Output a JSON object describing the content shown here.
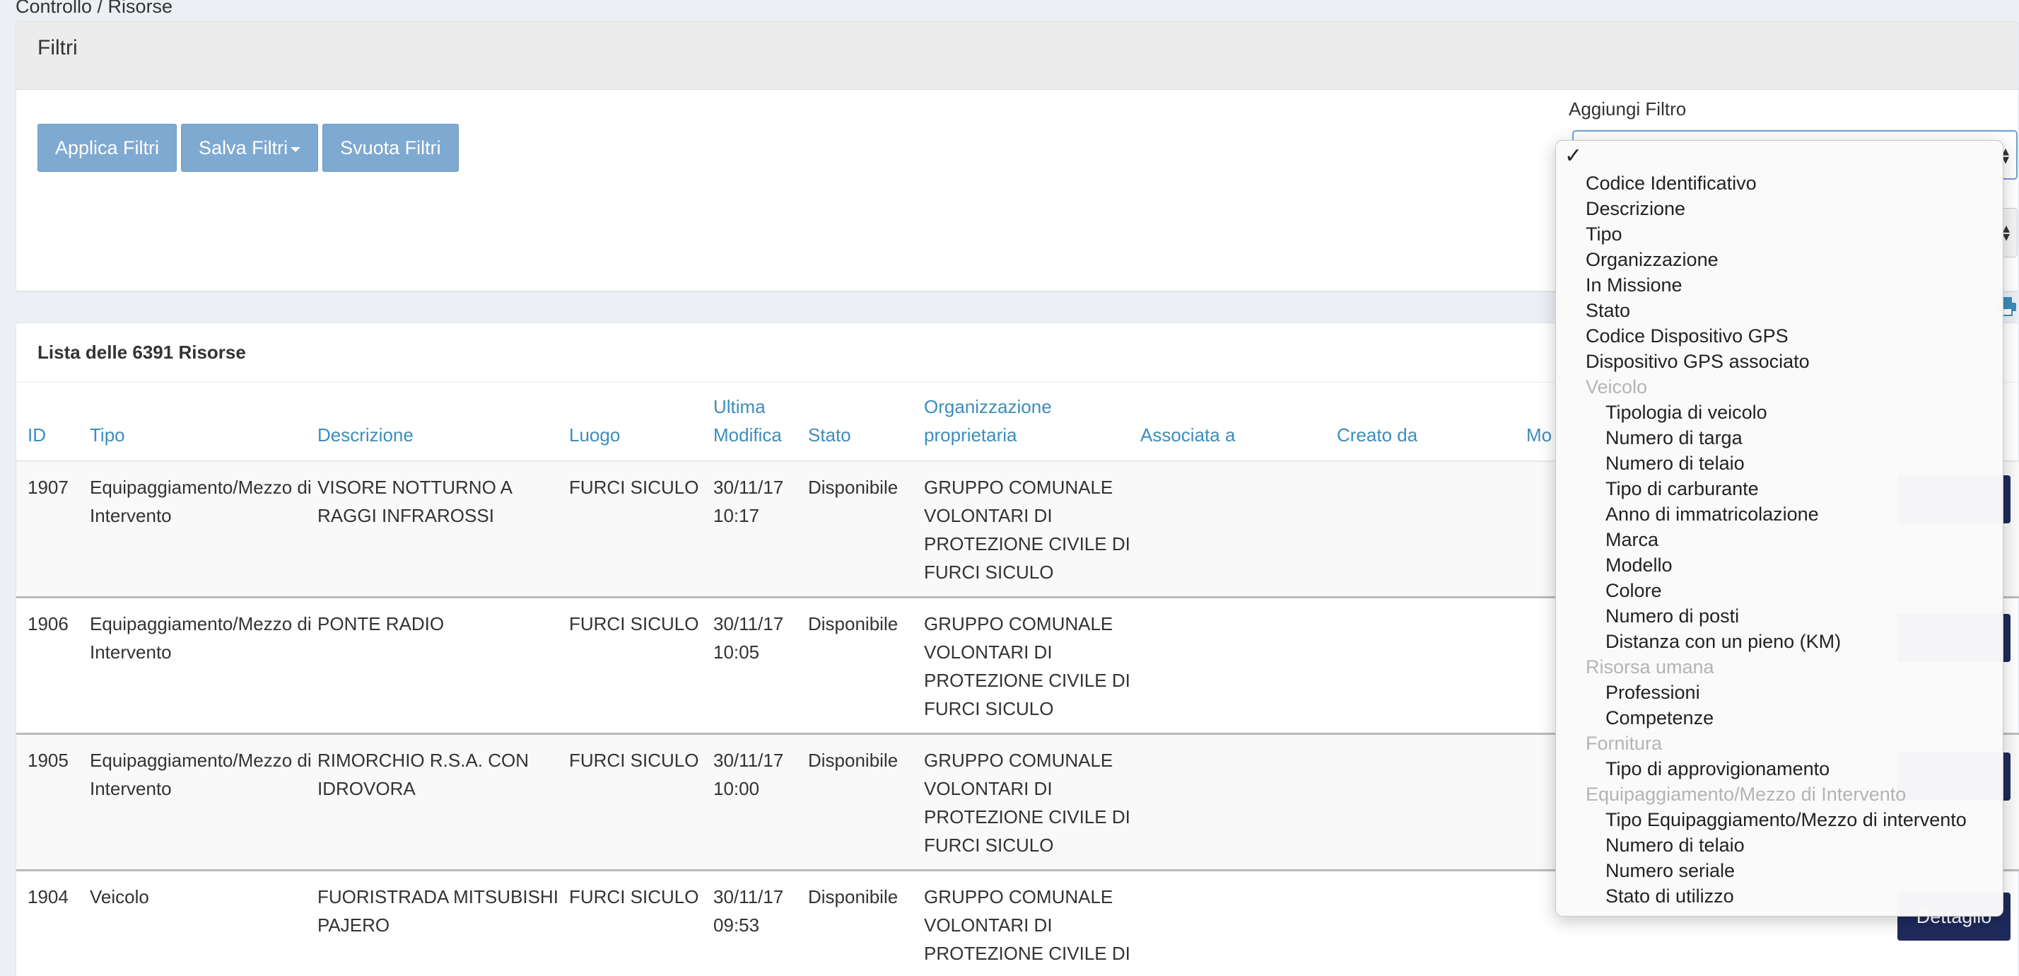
{
  "breadcrumb": "Controllo / Risorse",
  "filters": {
    "title": "Filtri",
    "apply_label": "Applica Filtri",
    "save_label": "Salva Filtri",
    "clear_label": "Svuota Filtri",
    "add_filter_label": "Aggiungi Filtro"
  },
  "list": {
    "title": "Lista delle 6391 Risorse",
    "columns": [
      "ID",
      "Tipo",
      "Descrizione",
      "Luogo",
      "Ultima Modifica",
      "Stato",
      "Organizzazione proprietaria",
      "Associata a",
      "Creato da",
      "Mo"
    ],
    "rows": [
      {
        "id": "1907",
        "tipo": "Equipaggiamento/Mezzo di Intervento",
        "descrizione": "VISORE NOTTURNO A RAGGI INFRAROSSI",
        "luogo": "FURCI SICULO",
        "modifica": "30/11/17 10:17",
        "stato": "Disponibile",
        "organizzazione": "GRUPPO COMUNALE VOLONTARI DI PROTEZIONE CIVILE DI FURCI SICULO",
        "associata": "",
        "creato": ""
      },
      {
        "id": "1906",
        "tipo": "Equipaggiamento/Mezzo di Intervento",
        "descrizione": "PONTE RADIO",
        "luogo": "FURCI SICULO",
        "modifica": "30/11/17 10:05",
        "stato": "Disponibile",
        "organizzazione": "GRUPPO COMUNALE VOLONTARI DI PROTEZIONE CIVILE DI FURCI SICULO",
        "associata": "",
        "creato": ""
      },
      {
        "id": "1905",
        "tipo": "Equipaggiamento/Mezzo di Intervento",
        "descrizione": "RIMORCHIO R.S.A. CON IDROVORA",
        "luogo": "FURCI SICULO",
        "modifica": "30/11/17 10:00",
        "stato": "Disponibile",
        "organizzazione": "GRUPPO COMUNALE VOLONTARI DI PROTEZIONE CIVILE DI FURCI SICULO",
        "associata": "",
        "creato": ""
      },
      {
        "id": "1904",
        "tipo": "Veicolo",
        "descrizione": "FUORISTRADA MITSUBISHI PAJERO",
        "luogo": "FURCI SICULO",
        "modifica": "30/11/17 09:53",
        "stato": "Disponibile",
        "organizzazione": "GRUPPO COMUNALE VOLONTARI DI PROTEZIONE CIVILE DI",
        "associata": "",
        "creato": ""
      }
    ],
    "detail_label": "Dettaglio"
  },
  "dropdown": {
    "check": "✓",
    "items": [
      {
        "label": "Codice Identificativo",
        "kind": "item"
      },
      {
        "label": "Descrizione",
        "kind": "item"
      },
      {
        "label": "Tipo",
        "kind": "item"
      },
      {
        "label": "Organizzazione",
        "kind": "item"
      },
      {
        "label": "In Missione",
        "kind": "item"
      },
      {
        "label": "Stato",
        "kind": "item"
      },
      {
        "label": "Codice Dispositivo GPS",
        "kind": "item"
      },
      {
        "label": "Dispositivo GPS associato",
        "kind": "item"
      },
      {
        "label": "Veicolo",
        "kind": "group"
      },
      {
        "label": "Tipologia di veicolo",
        "kind": "sub"
      },
      {
        "label": "Numero di targa",
        "kind": "sub"
      },
      {
        "label": "Numero di telaio",
        "kind": "sub"
      },
      {
        "label": "Tipo di carburante",
        "kind": "sub"
      },
      {
        "label": "Anno di immatricolazione",
        "kind": "sub"
      },
      {
        "label": "Marca",
        "kind": "sub"
      },
      {
        "label": "Modello",
        "kind": "sub"
      },
      {
        "label": "Colore",
        "kind": "sub"
      },
      {
        "label": "Numero di posti",
        "kind": "sub"
      },
      {
        "label": "Distanza con un pieno (KM)",
        "kind": "sub"
      },
      {
        "label": "Risorsa umana",
        "kind": "group"
      },
      {
        "label": "Professioni",
        "kind": "sub"
      },
      {
        "label": "Competenze",
        "kind": "sub"
      },
      {
        "label": "Fornitura",
        "kind": "group"
      },
      {
        "label": "Tipo di approvigionamento",
        "kind": "sub"
      },
      {
        "label": "Equipaggiamento/Mezzo di Intervento",
        "kind": "group"
      },
      {
        "label": "Tipo Equipaggiamento/Mezzo di intervento",
        "kind": "sub"
      },
      {
        "label": "Numero di telaio",
        "kind": "sub"
      },
      {
        "label": "Numero seriale",
        "kind": "sub"
      },
      {
        "label": "Stato di utilizzo",
        "kind": "sub"
      }
    ]
  }
}
